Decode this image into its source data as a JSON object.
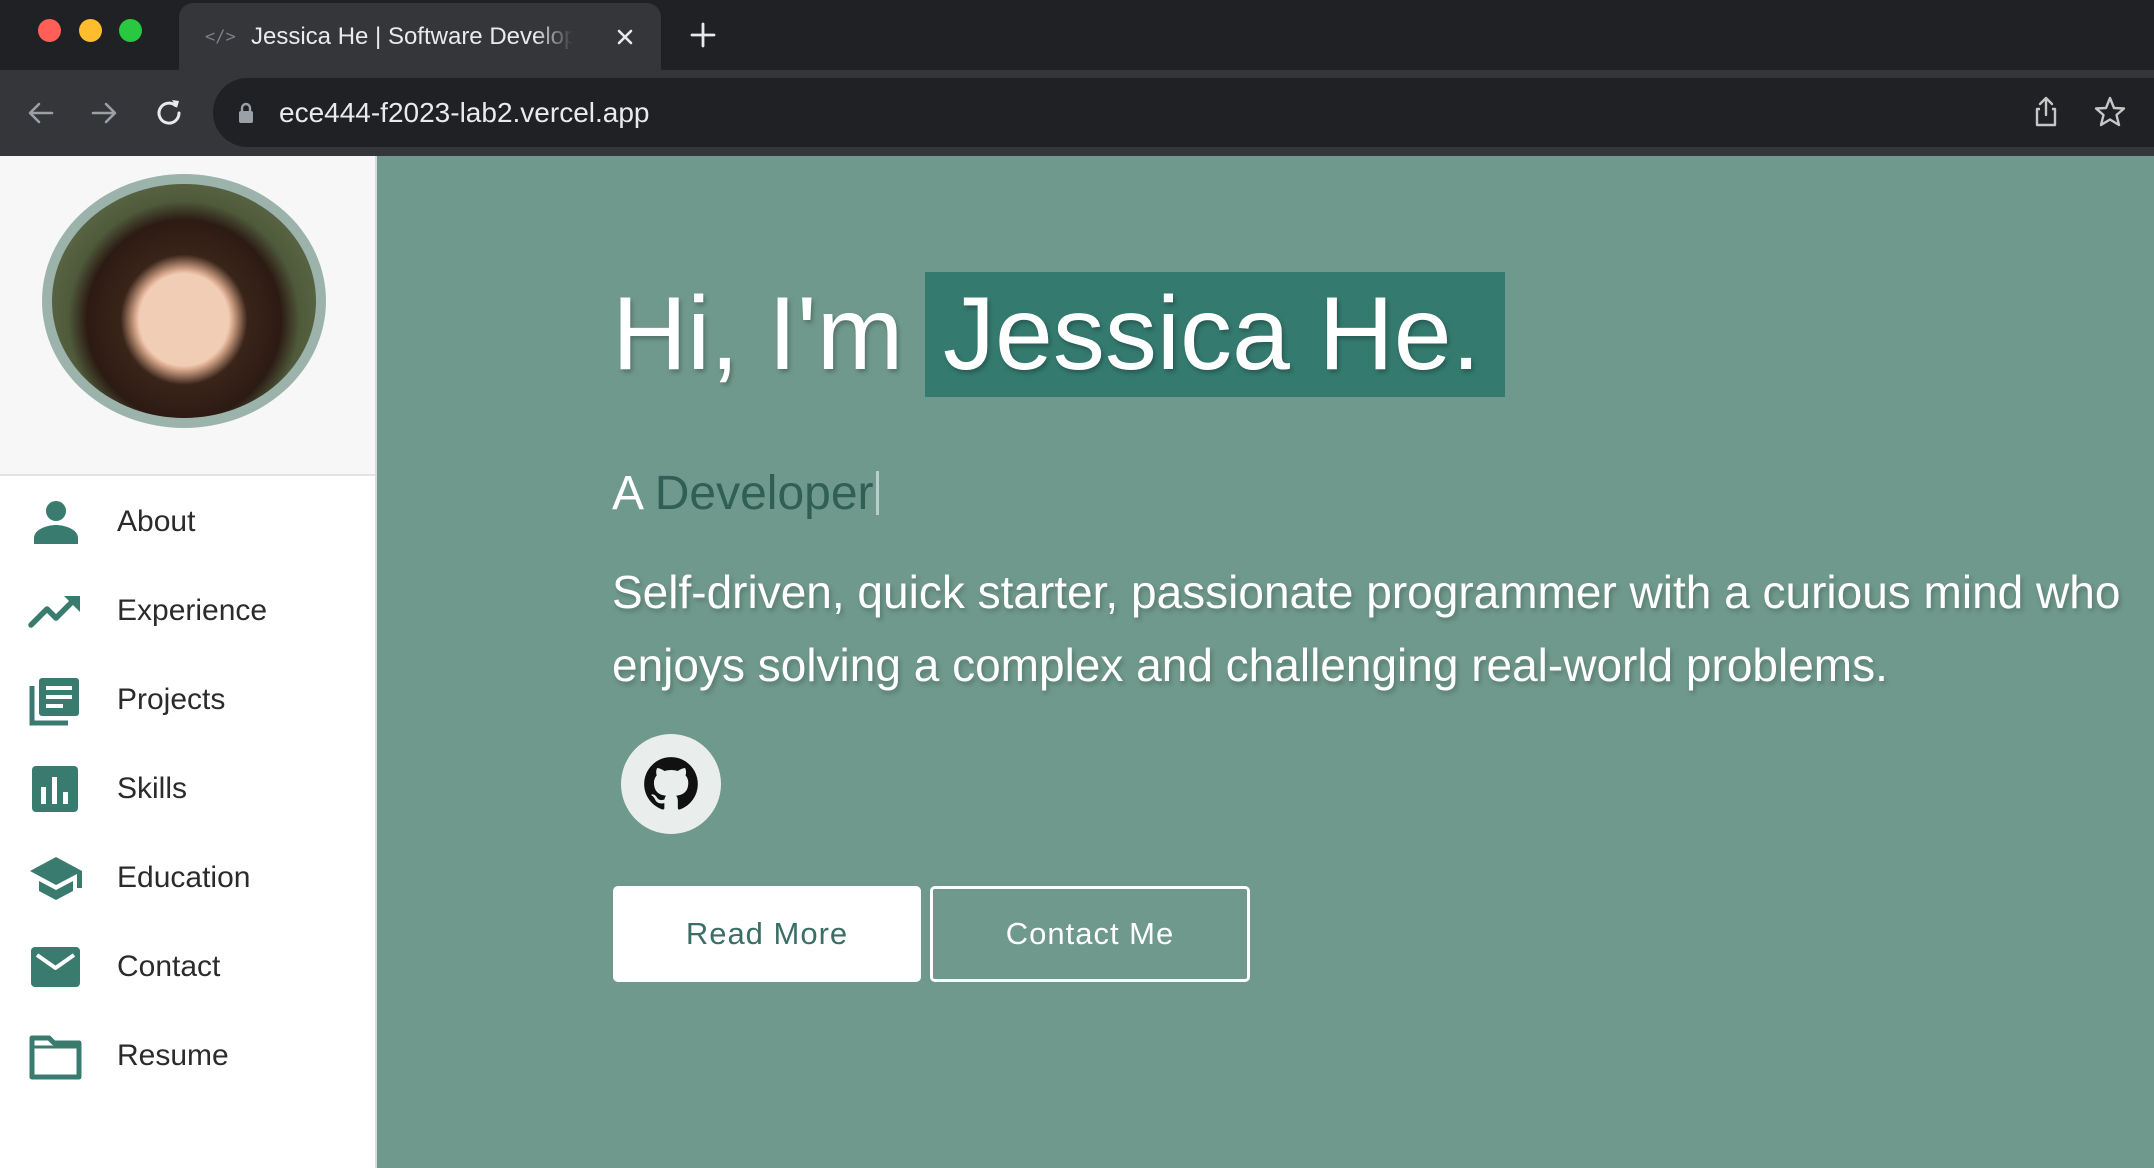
{
  "browser": {
    "tab_title": "Jessica He | Software Develop",
    "tab_icon": "code-icon",
    "url": "ece444-f2023-lab2.vercel.app"
  },
  "sidebar": {
    "items": [
      {
        "label": "About",
        "icon": "person-icon"
      },
      {
        "label": "Experience",
        "icon": "trending-up-icon"
      },
      {
        "label": "Projects",
        "icon": "article-icon"
      },
      {
        "label": "Skills",
        "icon": "bar-chart-icon"
      },
      {
        "label": "Education",
        "icon": "graduation-cap-icon"
      },
      {
        "label": "Contact",
        "icon": "mail-icon"
      },
      {
        "label": "Resume",
        "icon": "folder-icon"
      }
    ]
  },
  "hero": {
    "greeting": "Hi, I'm",
    "name": "Jessica He.",
    "role_prefix": "A",
    "role_word": "Developer",
    "bio": "Self-driven, quick starter, passionate programmer with a curious mind who enjoys solving a complex and challenging real-world problems.",
    "read_more_label": "Read More",
    "contact_label": "Contact Me"
  },
  "colors": {
    "accent": "#347a6f",
    "hero_bg": "#6f998c",
    "icon": "#3a7b70"
  }
}
